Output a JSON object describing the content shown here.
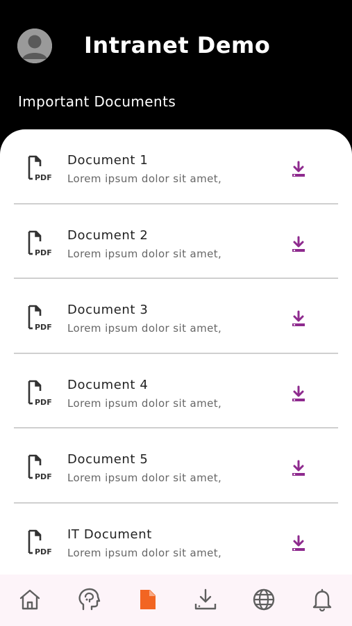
{
  "header": {
    "title": "Intranet Demo",
    "avatar_icon": "user-avatar-icon"
  },
  "section": {
    "title": "Important Documents"
  },
  "documents": [
    {
      "title": "Document 1",
      "subtitle": "Lorem ipsum dolor sit amet,"
    },
    {
      "title": "Document 2",
      "subtitle": "Lorem ipsum dolor sit amet,"
    },
    {
      "title": "Document 3",
      "subtitle": "Lorem ipsum dolor sit amet,"
    },
    {
      "title": "Document 4",
      "subtitle": "Lorem ipsum dolor sit amet,"
    },
    {
      "title": "Document 5",
      "subtitle": "Lorem ipsum dolor sit amet,"
    },
    {
      "title": "IT Document",
      "subtitle": "Lorem ipsum dolor sit amet,"
    }
  ],
  "row_icons": {
    "file": "pdf-file-icon",
    "action": "download-icon"
  },
  "bottom_nav": {
    "items": [
      {
        "icon": "home-icon",
        "active": false
      },
      {
        "icon": "head-brain-icon",
        "active": false
      },
      {
        "icon": "document-icon",
        "active": true
      },
      {
        "icon": "download-tray-icon",
        "active": false
      },
      {
        "icon": "globe-icon",
        "active": false
      },
      {
        "icon": "bell-icon",
        "active": false
      }
    ]
  },
  "colors": {
    "header_bg": "#000000",
    "accent_download": "#8e2a8e",
    "active_nav": "#f26522",
    "nav_icon": "#5f5f5f",
    "nav_bg": "#fdf4f9"
  }
}
